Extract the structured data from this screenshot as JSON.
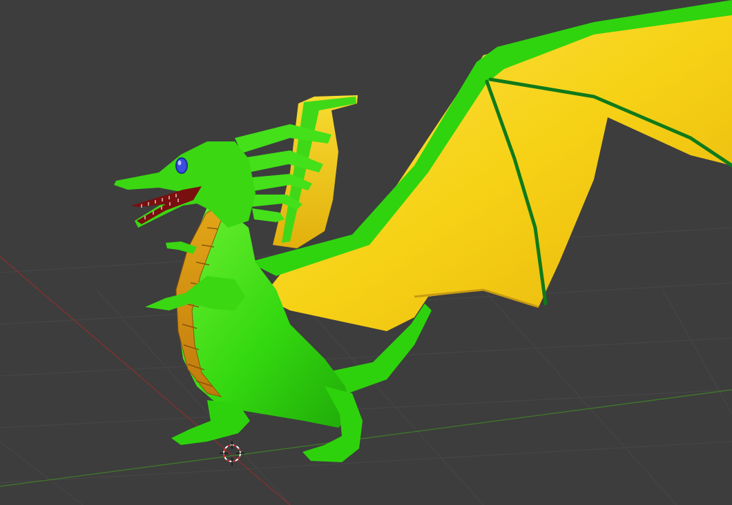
{
  "viewport": {
    "background_color": "#3d3d3d",
    "grid_color": "#454545",
    "x_axis_color": "#8a2f2f",
    "y_axis_color": "#3f7a28"
  },
  "scene": {
    "object": "green-dragon-model",
    "colors": {
      "body_green": "#2fd40e",
      "body_light": "#7cf03a",
      "body_dark": "#1a8f08",
      "wing_yellow": "#f4d20e",
      "wing_orange": "#e0a20b",
      "wing_vein": "#0f7a1a",
      "belly_gold": "#d6920f",
      "mouth_red": "#7a0f10",
      "eye_blue": "#3a4fe0"
    }
  },
  "cursor": {
    "icon": "3d-cursor-icon",
    "ring_color": "#ffffff",
    "ring_accent": "#d23030"
  }
}
